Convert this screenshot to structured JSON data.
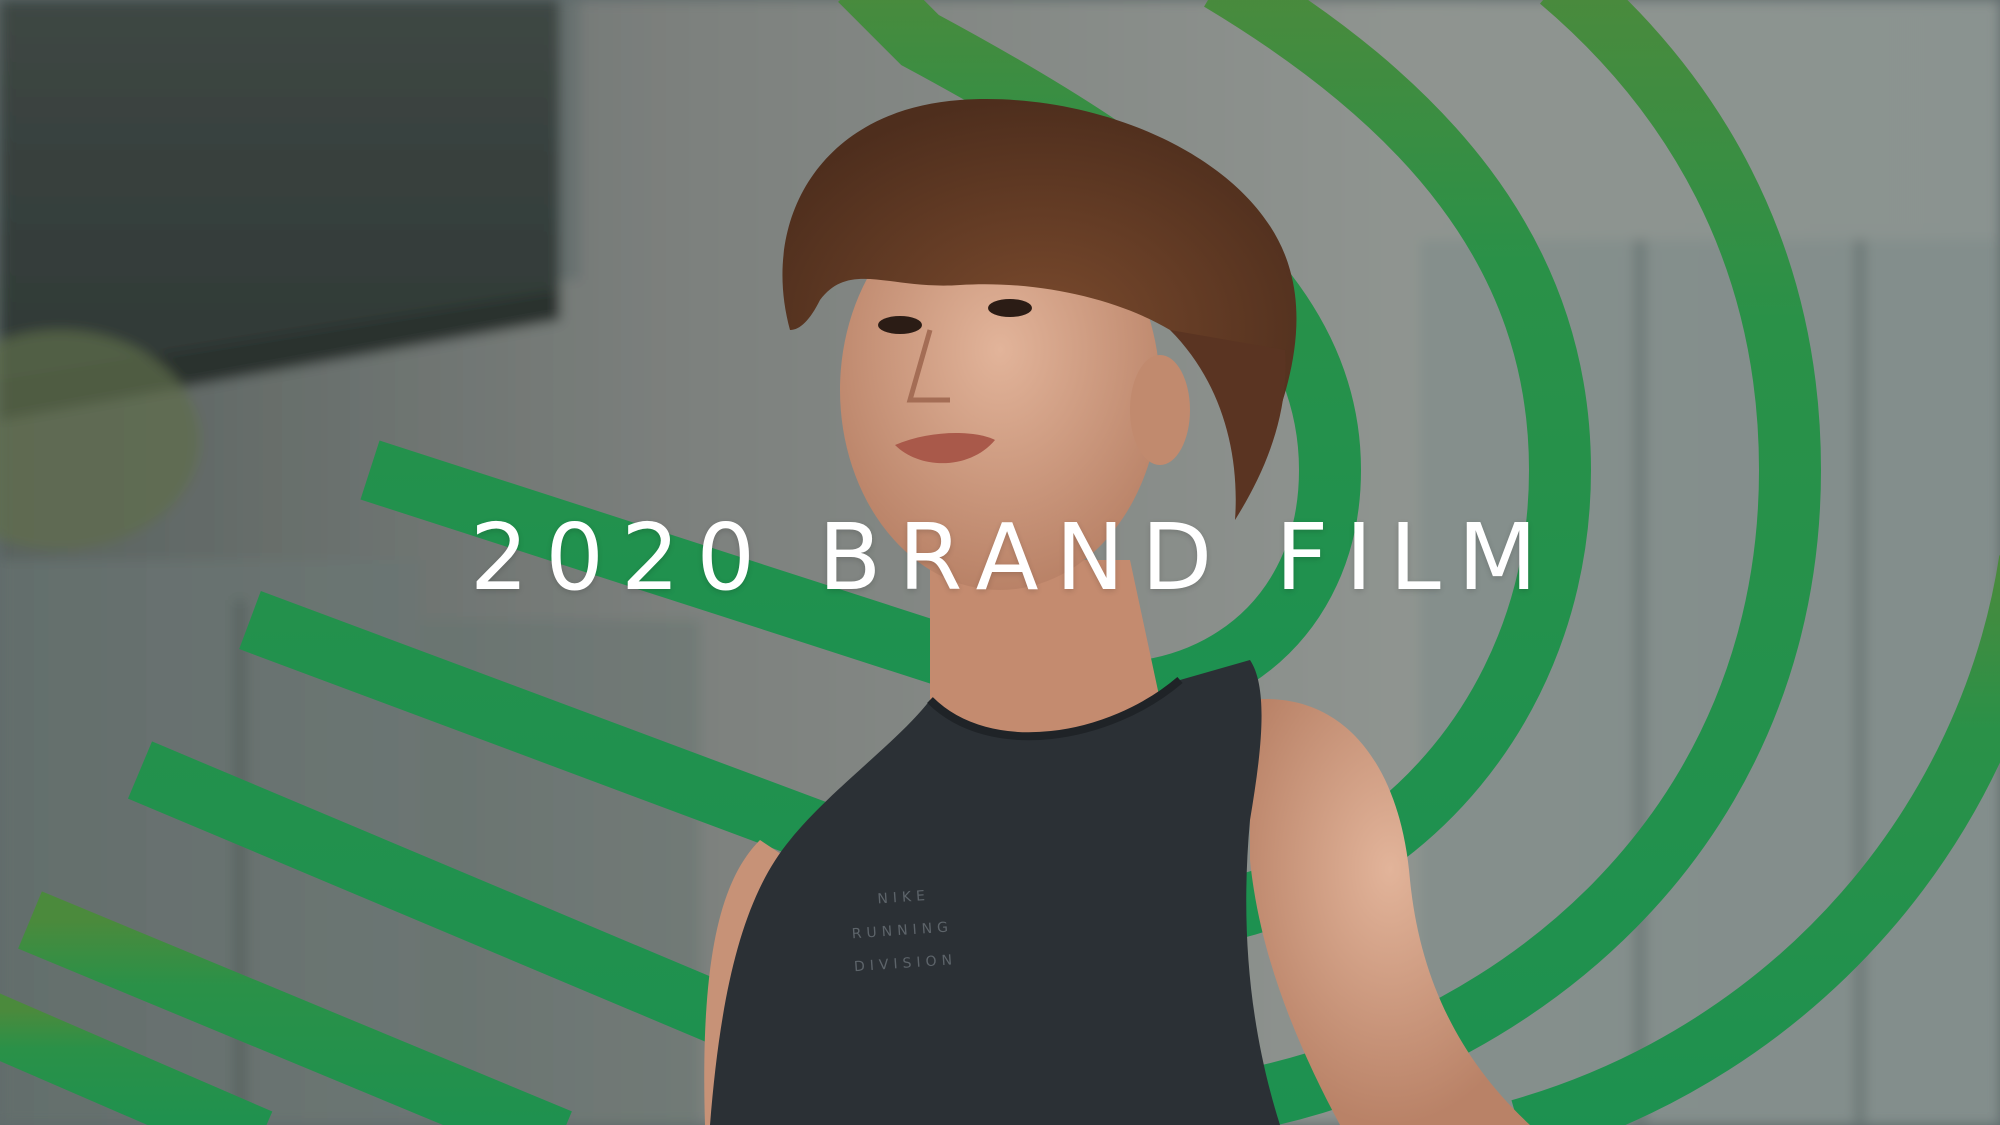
{
  "hero": {
    "title": "2020 BRAND FILM",
    "shirt_print": [
      "NIKE",
      "RUNNING",
      "DIVISION"
    ]
  },
  "colors": {
    "brand_green": "#1e9150",
    "brand_green_top": "#4a8a3a",
    "wall_concrete": "#8a8f8c",
    "shirt": "#2b3035",
    "skin": "#d9a98f",
    "hair": "#6b3f27"
  }
}
